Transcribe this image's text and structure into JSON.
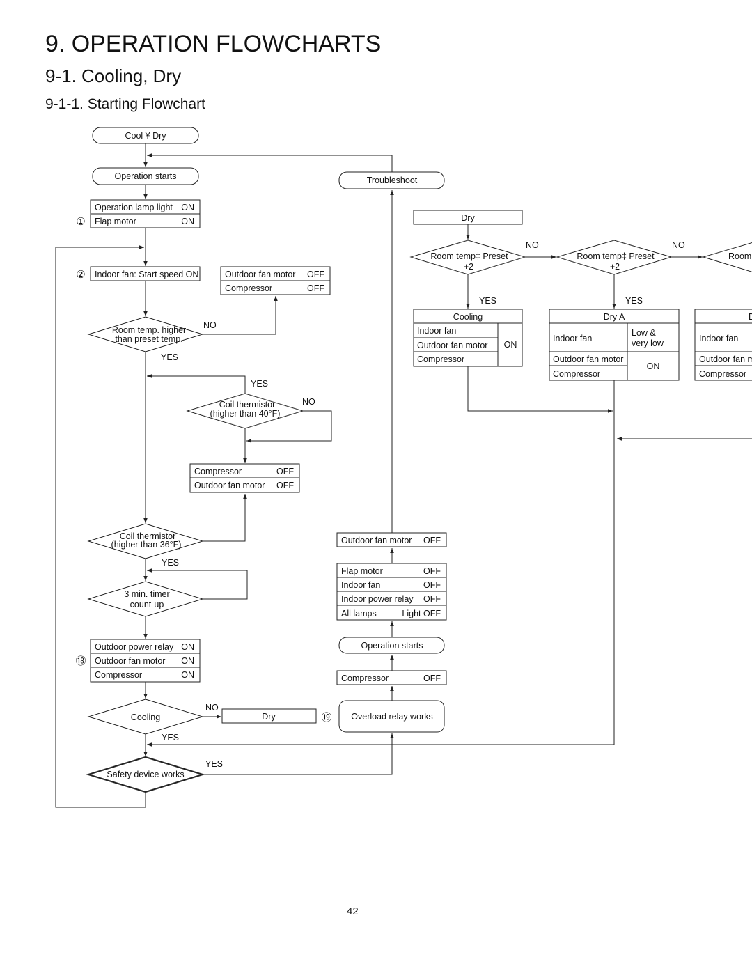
{
  "headings": {
    "chapter": "9. OPERATION FLOWCHARTS",
    "section": "9-1. Cooling, Dry",
    "subsection": "9-1-1. Starting Flowchart"
  },
  "page_number": "42",
  "left": {
    "start": "Cool ¥ Dry",
    "op_starts": "Operation starts",
    "box1": {
      "marker": "①",
      "rows": [
        [
          "Operation lamp light",
          "ON"
        ],
        [
          "Flap motor",
          "ON"
        ]
      ]
    },
    "box2": {
      "marker": "②",
      "text": "Indoor fan: Start speed ON"
    },
    "box_off1": {
      "rows": [
        [
          "Outdoor fan motor",
          "OFF"
        ],
        [
          "Compressor",
          "OFF"
        ]
      ]
    },
    "dec_room": {
      "line1": "Room temp. higher",
      "line2": "than preset temp.",
      "no": "NO",
      "yes": "YES"
    },
    "dec_coil40": {
      "line1": "Coil thermistor",
      "line2": "(higher than 40°F)",
      "no": "NO",
      "yes": "YES"
    },
    "box_off2": {
      "rows": [
        [
          "Compressor",
          "OFF"
        ],
        [
          "Outdoor fan motor",
          "OFF"
        ]
      ]
    },
    "dec_coil36": {
      "line1": "Coil thermistor",
      "line2": "(higher than 36°F)",
      "yes": "YES"
    },
    "dec_timer": {
      "line1": "3 min. timer",
      "line2": "count-up"
    },
    "box18": {
      "marker": "⑱",
      "rows": [
        [
          "Outdoor power relay",
          "ON"
        ],
        [
          "Outdoor fan motor",
          "ON"
        ],
        [
          "Compressor",
          "ON"
        ]
      ]
    },
    "dec_cooling": {
      "text": "Cooling",
      "no": "NO",
      "yes": "YES"
    },
    "dry_box": "Dry",
    "dec_safety": {
      "text": "Safety device works",
      "yes": "YES"
    }
  },
  "middle": {
    "troubleshoot": "Troubleshoot",
    "box_ofm": {
      "rows": [
        [
          "Outdoor fan motor",
          "OFF"
        ]
      ]
    },
    "box_off4": {
      "rows": [
        [
          "Flap motor",
          "OFF"
        ],
        [
          "Indoor fan",
          "OFF"
        ],
        [
          "Indoor power relay",
          "OFF"
        ],
        [
          "All lamps",
          "Light OFF"
        ]
      ]
    },
    "op_starts": "Operation starts",
    "box_comp": {
      "rows": [
        [
          "Compressor",
          "OFF"
        ]
      ]
    },
    "marker19": "⑲",
    "overload": "Overload relay works"
  },
  "right": {
    "dry": "Dry",
    "dec1": {
      "line1": "Room temp‡ Preset",
      "line2": "+2",
      "no": "NO",
      "yes": "YES"
    },
    "dec2": {
      "line1": "Room temp‡ Preset",
      "line2": "+2",
      "no": "NO",
      "yes": "YES"
    },
    "dec3": {
      "line1": "Room"
    },
    "cooling": {
      "title": "Cooling",
      "rows": [
        "Indoor fan",
        "Outdoor fan motor",
        "Compressor"
      ],
      "state": "ON"
    },
    "dry_a": {
      "title": "Dry A",
      "indoor_fan": "Indoor fan",
      "fan_state1": "Low &",
      "fan_state2": "very low",
      "rows": [
        "Outdoor fan motor",
        "Compressor"
      ],
      "state": "ON"
    },
    "dry_b": {
      "title": "D",
      "indoor_fan": "Indoor fan",
      "rows": [
        "Outdoor fan m",
        "Compressor"
      ]
    }
  }
}
